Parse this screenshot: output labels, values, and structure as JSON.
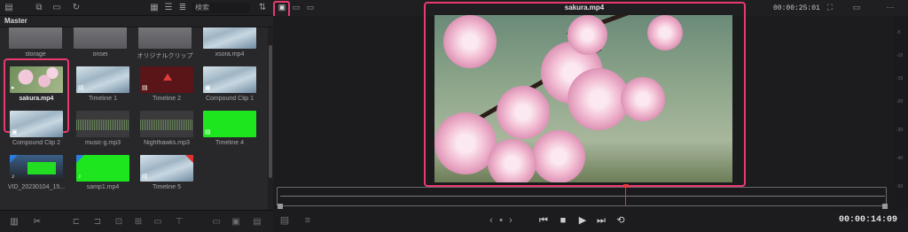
{
  "pool": {
    "search_placeholder": "検索",
    "master_label": "Master",
    "clips": [
      {
        "name": "clip-storage",
        "label": "storage",
        "thumb": "folder"
      },
      {
        "name": "clip-onsei",
        "label": "onsei",
        "thumb": "folder"
      },
      {
        "name": "clip-original",
        "label": "オリジナルクリップ",
        "thumb": "folder"
      },
      {
        "name": "clip-xsora",
        "label": "xsora.mp4",
        "thumb": "sky"
      },
      {
        "name": "clip-sakura",
        "label": "sakura.mp4",
        "thumb": "sakura",
        "selected": true
      },
      {
        "name": "clip-timeline1",
        "label": "Timeline 1",
        "thumb": "sky"
      },
      {
        "name": "clip-timeline2",
        "label": "Timeline 2",
        "thumb": "red"
      },
      {
        "name": "clip-compound1",
        "label": "Compound Clip 1",
        "thumb": "sky"
      },
      {
        "name": "clip-compound2",
        "label": "Compound Clip 2",
        "thumb": "sky"
      },
      {
        "name": "clip-music",
        "label": "music-g.mp3",
        "thumb": "wave"
      },
      {
        "name": "clip-nighthawks",
        "label": "Nighthawks.mp3",
        "thumb": "wave"
      },
      {
        "name": "clip-timeline4",
        "label": "Timeline 4",
        "thumb": "green"
      },
      {
        "name": "clip-vid",
        "label": "VID_20230104_15...",
        "thumb": "vid"
      },
      {
        "name": "clip-samp1",
        "label": "samp1.mp4",
        "thumb": "green"
      },
      {
        "name": "clip-timeline5",
        "label": "Timeline 5",
        "thumb": "sky"
      }
    ]
  },
  "viewer": {
    "clip_title": "sakura.mp4",
    "source_timecode": "00:00:25:01",
    "playhead_timecode": "00:00:14:09",
    "meter_ticks": [
      "-5",
      "-10",
      "-15",
      "-20",
      "-30",
      "-40",
      "-50"
    ]
  },
  "icons": {
    "highlight_color": "#e8396f",
    "playhead_color": "#e23b3b"
  }
}
